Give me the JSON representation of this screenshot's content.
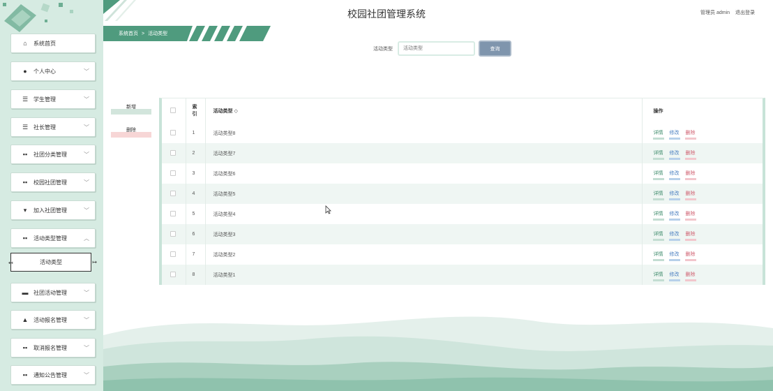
{
  "header": {
    "title": "校园社团管理系统",
    "user_role": "管理员 admin",
    "logout": "退出登录"
  },
  "breadcrumb": {
    "home": "系统首页",
    "separator": ">",
    "current": "活动类型"
  },
  "sidebar": {
    "items": [
      {
        "label": "系统首页",
        "icon": "home-icon",
        "glyph": "⌂",
        "arrow": ""
      },
      {
        "label": "个人中心",
        "icon": "user-icon",
        "glyph": "●",
        "arrow": "﹀"
      },
      {
        "label": "学生管理",
        "icon": "list-icon",
        "glyph": "☰",
        "arrow": "﹀"
      },
      {
        "label": "社长管理",
        "icon": "list-icon",
        "glyph": "☰",
        "arrow": "﹀"
      },
      {
        "label": "社团分类管理",
        "icon": "grid-icon",
        "glyph": "▪▪",
        "arrow": "﹀"
      },
      {
        "label": "校园社团管理",
        "icon": "grid-icon",
        "glyph": "▪▪",
        "arrow": "﹀"
      },
      {
        "label": "加入社团管理",
        "icon": "cup-icon",
        "glyph": "▾",
        "arrow": "﹀"
      },
      {
        "label": "活动类型管理",
        "icon": "grid-icon",
        "glyph": "▪▪",
        "arrow": "︿"
      },
      {
        "label": "社团活动管理",
        "icon": "print-icon",
        "glyph": "▬",
        "arrow": "﹀"
      },
      {
        "label": "活动报名管理",
        "icon": "thumb-icon",
        "glyph": "▲",
        "arrow": "﹀"
      },
      {
        "label": "取消报名管理",
        "icon": "grid-icon",
        "glyph": "▪▪",
        "arrow": "﹀"
      },
      {
        "label": "通知公告管理",
        "icon": "grid-icon",
        "glyph": "▪▪",
        "arrow": "﹀"
      }
    ],
    "sub_item": {
      "label": "活动类型",
      "left_glyph": "↤",
      "right_glyph": "↦"
    }
  },
  "search": {
    "label": "活动类型",
    "placeholder": "活动类型",
    "button": "查询"
  },
  "actions": {
    "add": "新增",
    "delete": "删除"
  },
  "table": {
    "headers": {
      "index": "索\n引",
      "type": "活动类型 ◇",
      "ops": "操作"
    },
    "rows": [
      {
        "index": "1",
        "type": "活动类型8"
      },
      {
        "index": "2",
        "type": "活动类型7"
      },
      {
        "index": "3",
        "type": "活动类型6"
      },
      {
        "index": "4",
        "type": "活动类型5"
      },
      {
        "index": "5",
        "type": "活动类型4"
      },
      {
        "index": "6",
        "type": "活动类型3"
      },
      {
        "index": "7",
        "type": "活动类型2"
      },
      {
        "index": "8",
        "type": "活动类型1"
      }
    ],
    "op_labels": {
      "detail": "详情",
      "edit": "修改",
      "delete": "删除"
    }
  },
  "colors": {
    "sidebar_bg": "#d6ebe2",
    "accent_green": "#4f9b7e",
    "search_button": "#7f95ad"
  }
}
